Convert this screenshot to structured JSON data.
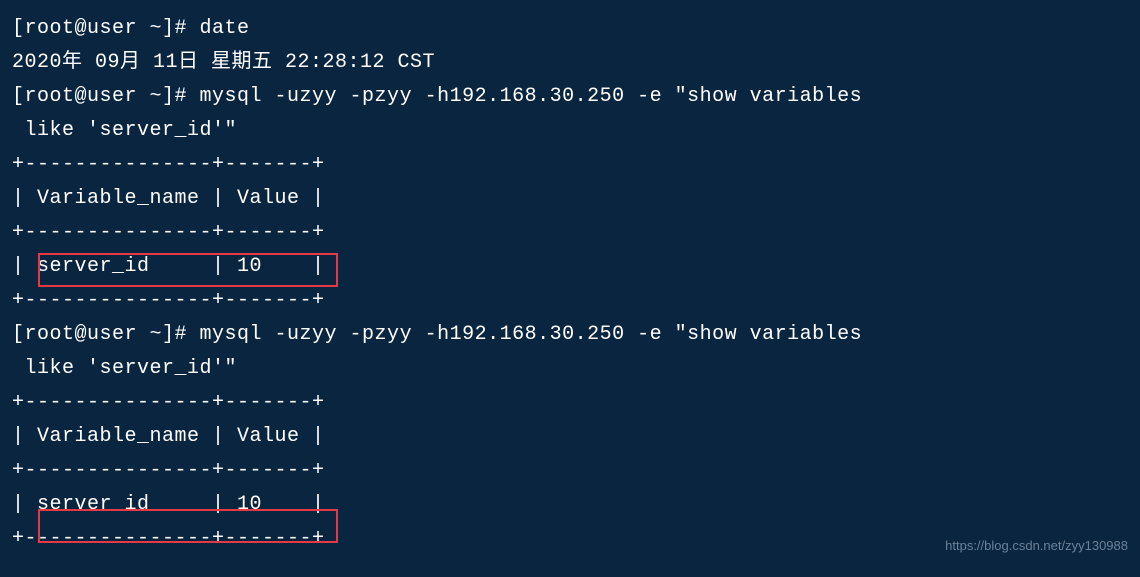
{
  "terminal": {
    "prompt1": "[root@user ~]# ",
    "cmd_date": "date",
    "date_output": "2020年 09月 11日 星期五 22:28:12 CST",
    "prompt2": "[root@user ~]# ",
    "cmd_mysql1_part1": "mysql -uzyy -pzyy -h192.168.30.250 -e \"show variables",
    "cmd_mysql1_part2": " like 'server_id'\"",
    "table_border": "+---------------+-------+",
    "table_header": "| Variable_name | Value |",
    "table_row": "| server_id     | 10    |",
    "prompt3": "[root@user ~]# ",
    "cmd_mysql2_part1": "mysql -uzyy -pzyy -h192.168.30.250 -e \"show variables",
    "cmd_mysql2_part2": " like 'server_id'\"",
    "table2_border": "+---------------+-------+",
    "table2_header": "| Variable_name | Value |",
    "table2_row": "| server_id     | 10    |"
  },
  "watermark": "https://blog.csdn.net/zyy130988"
}
